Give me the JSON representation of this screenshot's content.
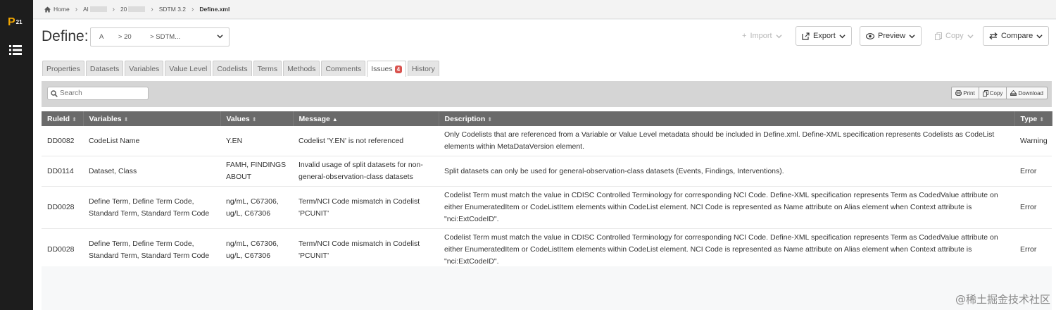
{
  "app": {
    "logo_text": "P",
    "logo_superscript": "21"
  },
  "breadcrumb": {
    "home": "Home",
    "item2": "Al",
    "item3": "20",
    "item4": "SDTM 3.2",
    "current": "Define.xml"
  },
  "header": {
    "title": "Define:",
    "selector_value": "A        > 20          > SDTM...",
    "import_label": "Import",
    "export_label": "Export",
    "preview_label": "Preview",
    "copy_label": "Copy",
    "compare_label": "Compare"
  },
  "tabs": [
    {
      "label": "Properties"
    },
    {
      "label": "Datasets"
    },
    {
      "label": "Variables"
    },
    {
      "label": "Value Level"
    },
    {
      "label": "Codelists"
    },
    {
      "label": "Terms"
    },
    {
      "label": "Methods"
    },
    {
      "label": "Comments"
    },
    {
      "label": "Issues",
      "badge": "4",
      "active": true
    },
    {
      "label": "History"
    }
  ],
  "toolbar": {
    "search_placeholder": "Search",
    "print_label": "Print",
    "copy_label": "Copy",
    "download_label": "Download"
  },
  "table": {
    "columns": [
      "RuleId",
      "Variables",
      "Values",
      "Message",
      "Description",
      "Type"
    ],
    "sort_markers": [
      "⬍",
      "⬍",
      "⬍",
      "▲",
      "⬍",
      "⬍"
    ],
    "rows": [
      {
        "ruleid": "DD0082",
        "variables": "CodeList Name",
        "values": "Y.EN",
        "message": "Codelist 'Y.EN' is not referenced",
        "description": "Only Codelists that are referenced from a Variable or Value Level metadata should be included in Define.xml. Define-XML specification represents Codelists as CodeList elements within MetaDataVersion element.",
        "type": "Warning"
      },
      {
        "ruleid": "DD0114",
        "variables": "Dataset, Class",
        "values": "FAMH, FINDINGS ABOUT",
        "message": "Invalid usage of split datasets for non-general-observation-class datasets",
        "description": "Split datasets can only be used for general-observation-class datasets (Events, Findings, Interventions).",
        "type": "Error"
      },
      {
        "ruleid": "DD0028",
        "variables": "Define Term, Define Term Code, Standard Term, Standard Term Code",
        "values": "ng/mL, C67306, ug/L, C67306",
        "message": "Term/NCI Code mismatch in Codelist 'PCUNIT'",
        "description": "Codelist Term must match the value in CDISC Controlled Terminology for corresponding NCI Code. Define-XML specification represents Term as CodedValue attribute on either EnumeratedItem or CodeListItem elements within CodeList element. NCI Code is represented as Name attribute on Alias element when Context attribute is \"nci:ExtCodeID\".",
        "type": "Error"
      },
      {
        "ruleid": "DD0028",
        "variables": "Define Term, Define Term Code, Standard Term, Standard Term Code",
        "values": "ng/mL, C67306, ug/L, C67306",
        "message": "Term/NCI Code mismatch in Codelist 'PCUNIT'",
        "description": "Codelist Term must match the value in CDISC Controlled Terminology for corresponding NCI Code. Define-XML specification represents Term as CodedValue attribute on either EnumeratedItem or CodeListItem elements within CodeList element. NCI Code is represented as Name attribute on Alias element when Context attribute is \"nci:ExtCodeID\".",
        "type": "Error"
      }
    ]
  },
  "watermark": "@稀土掘金技术社区",
  "colors": {
    "sidebar": "#1d1d1d",
    "logo": "#f0a500",
    "table_header": "#6a6a6a",
    "badge": "#d9534f"
  }
}
